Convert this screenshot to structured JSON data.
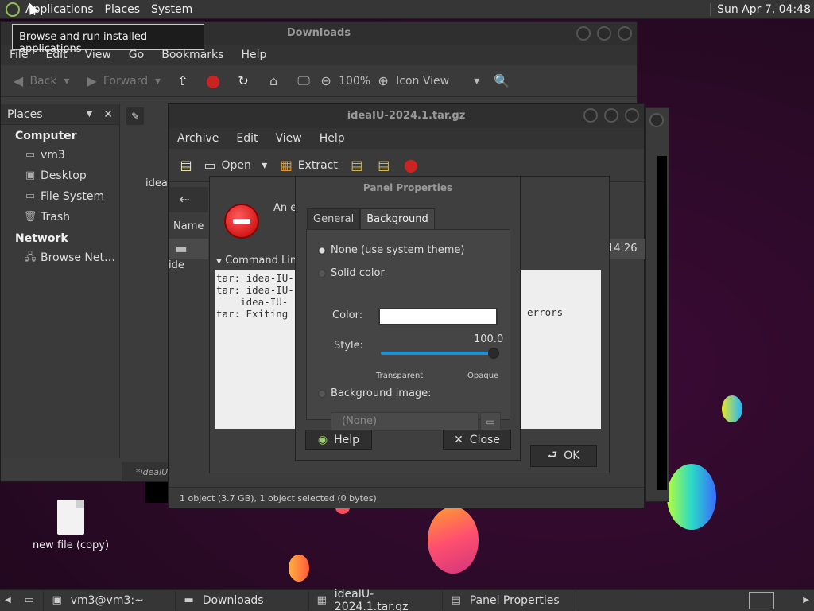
{
  "top_panel": {
    "menus": [
      "Applications",
      "Places",
      "System"
    ],
    "clock": "Sun Apr  7, 04:48",
    "tooltip": "Browse and run installed applications"
  },
  "file_manager": {
    "title": "Downloads",
    "menus": [
      "File",
      "Edit",
      "View",
      "Go",
      "Bookmarks",
      "Help"
    ],
    "toolbar": {
      "back": "Back",
      "forward": "Forward",
      "zoom": "100%",
      "view_mode": "Icon View"
    },
    "sidebar": {
      "header": "Places",
      "sections": [
        {
          "title": "Computer",
          "items": [
            {
              "icon": "drive-icon",
              "label": "vm3"
            },
            {
              "icon": "desktop-icon",
              "label": "Desktop"
            },
            {
              "icon": "drive-icon",
              "label": "File System"
            },
            {
              "icon": "trash-icon",
              "label": "Trash"
            }
          ]
        },
        {
          "title": "Network",
          "items": [
            {
              "icon": "network-icon",
              "label": "Browse Net…"
            }
          ]
        }
      ]
    },
    "file_label": "idea-",
    "status": "*idealU-"
  },
  "archive_manager": {
    "title": "ideaIU-2024.1.tar.gz",
    "menus": [
      "Archive",
      "Edit",
      "View",
      "Help"
    ],
    "toolbar": {
      "open": "Open",
      "extract": "Extract"
    },
    "name_column": "Name",
    "row_label": "ide",
    "row_time": "14:26",
    "status": "1 object (3.7 GB), 1 object selected (0 bytes)"
  },
  "error_dialog": {
    "message": "An e",
    "expander": "Command Lin",
    "log_lines": [
      "tar: idea-IU-",
      "tar: idea-IU-",
      "    idea-IU-",
      "tar: Exiting"
    ],
    "log_tail": "errors",
    "ok": "OK"
  },
  "panel_properties": {
    "title": "Panel Properties",
    "tabs": [
      "General",
      "Background"
    ],
    "options": {
      "none": "None (use system theme)",
      "solid": "Solid color",
      "image": "Background image:"
    },
    "color_label": "Color:",
    "color_value": "#ffffff",
    "style_label": "Style:",
    "style_value": "100.0",
    "transparent": "Transparent",
    "opaque": "Opaque",
    "image_chooser": "(None)",
    "help": "Help",
    "close": "Close"
  },
  "desktop": {
    "icon_label": "new file (copy)"
  },
  "taskbar": {
    "tasks": [
      "vm3@vm3:~",
      "Downloads",
      "ideaIU-2024.1.tar.gz",
      "Panel Properties"
    ]
  }
}
